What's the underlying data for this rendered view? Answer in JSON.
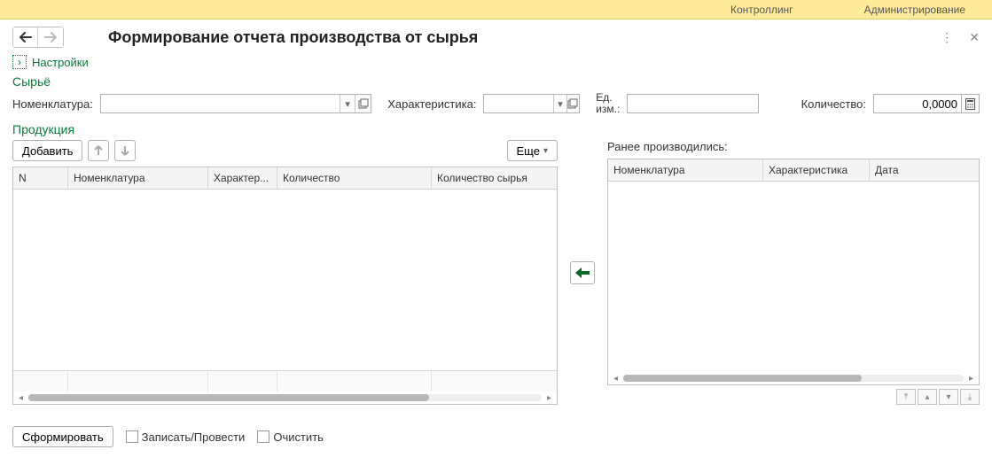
{
  "tabs": {
    "controlling": "Контроллинг",
    "admin": "Администрирование"
  },
  "header": {
    "title": "Формирование отчета производства от сырья"
  },
  "settings_link": "Настройки",
  "sections": {
    "raw": "Сырьё",
    "product": "Продукция"
  },
  "raw": {
    "nomenclature_label": "Номенклатура:",
    "characteristic_label": "Характеристика:",
    "unit_label_line1": "Ед.",
    "unit_label_line2": "изм.:",
    "quantity_label": "Количество:",
    "quantity_value": "0,0000"
  },
  "toolbar": {
    "add": "Добавить",
    "more": "Еще"
  },
  "left_table": {
    "cols": {
      "n": "N",
      "nomen": "Номенклатура",
      "charact": "Характер...",
      "qty": "Количество",
      "qty_raw": "Количество сырья"
    },
    "widths": {
      "n": 62,
      "nomen": 158,
      "charact": 78,
      "qty": 174,
      "qty_raw": 124
    }
  },
  "right_block": {
    "label": "Ранее производились:",
    "cols": {
      "nomen": "Номенклатура",
      "charact": "Характеристика",
      "date": "Дата"
    },
    "widths": {
      "nomen": 175,
      "charact": 120,
      "date": 115
    }
  },
  "footer": {
    "form": "Сформировать",
    "write_post": "Записать/Провести",
    "clear": "Очистить"
  }
}
